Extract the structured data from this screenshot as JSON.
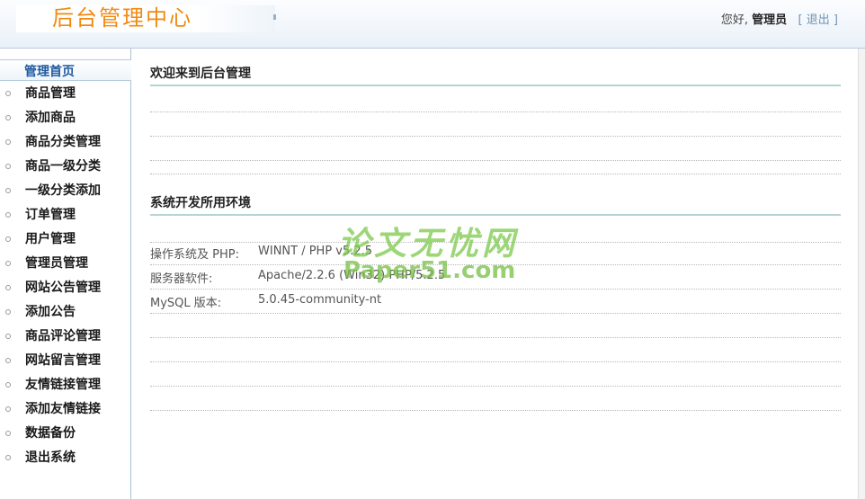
{
  "header": {
    "brand": "后台管理中心",
    "greeting": "您好,",
    "username": "管理员",
    "bracket_open": "[",
    "logout": "退出",
    "bracket_close": "]"
  },
  "sidebar": {
    "home": "管理首页",
    "items": [
      {
        "label": "商品管理"
      },
      {
        "label": "添加商品"
      },
      {
        "label": "商品分类管理"
      },
      {
        "label": "商品一级分类"
      },
      {
        "label": "一级分类添加"
      },
      {
        "label": "订单管理"
      },
      {
        "label": "用户管理"
      },
      {
        "label": "管理员管理"
      },
      {
        "label": "网站公告管理"
      },
      {
        "label": "添加公告"
      },
      {
        "label": "商品评论管理"
      },
      {
        "label": "网站留言管理"
      },
      {
        "label": "友情链接管理"
      },
      {
        "label": "添加友情链接"
      },
      {
        "label": "数据备份"
      },
      {
        "label": "退出系统"
      }
    ]
  },
  "main": {
    "welcome_title": "欢迎来到后台管理",
    "env_title": "系统开发所用环境",
    "env_rows": [
      {
        "key": "操作系统及 PHP:",
        "value": "WINNT / PHP v5.2.5"
      },
      {
        "key": "服务器软件:",
        "value": "Apache/2.2.6 (Win32) PHP/5.2.5"
      },
      {
        "key": "MySQL 版本:",
        "value": "5.0.45-community-nt"
      }
    ]
  },
  "watermark": {
    "line1": "论文无忧网",
    "line2": "Paper51.com"
  },
  "colors": {
    "brand": "#f08a12",
    "accent_line": "#b5d3d3",
    "nav_home": "#1f5aa0",
    "watermark": "#7bc94a"
  }
}
